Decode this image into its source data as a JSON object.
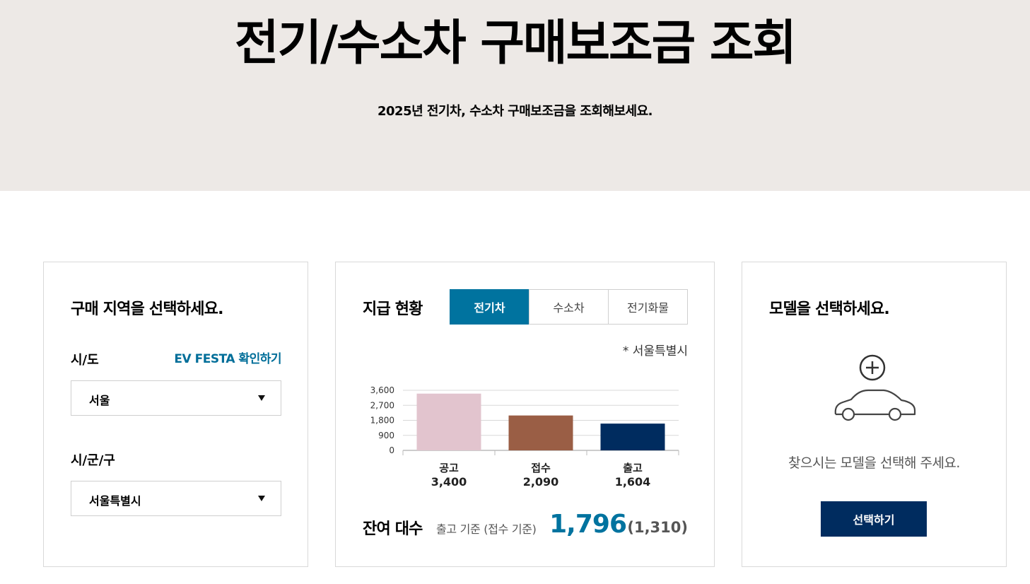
{
  "hero": {
    "title": "전기/수소차 구매보조금 조회",
    "subtitle": "2025년 전기차, 수소차 구매보조금을 조회해보세요."
  },
  "region": {
    "title": "구매 지역을 선택하세요.",
    "sido_label": "시/도",
    "festa_link": "EV FESTA 확인하기",
    "sido_value": "서울",
    "sigungu_label": "시/군/구",
    "sigungu_value": "서울특별시"
  },
  "status": {
    "title": "지급 현황",
    "tabs": [
      {
        "label": "전기차",
        "active": true
      },
      {
        "label": "수소차",
        "active": false
      },
      {
        "label": "전기화물",
        "active": false
      }
    ],
    "region_note": "* 서울특별시",
    "remain_label": "잔여 대수",
    "remain_basis": "출고 기준 (접수 기준)",
    "remain_value": "1,796",
    "remain_sub": "(1,310)"
  },
  "chart_data": {
    "type": "bar",
    "categories": [
      "공고",
      "접수",
      "출고"
    ],
    "values": [
      3400,
      2090,
      1604
    ],
    "value_labels": [
      "3,400",
      "2,090",
      "1,604"
    ],
    "bar_colors": [
      "#e2c4ce",
      "#9a5e45",
      "#002c5f"
    ],
    "y_ticks": [
      0,
      900,
      1800,
      2700,
      3600
    ],
    "y_tick_labels": [
      "0",
      "900",
      "1,800",
      "2,700",
      "3,600"
    ],
    "ylim": [
      0,
      3600
    ],
    "grid": true
  },
  "model": {
    "title": "모델을 선택하세요.",
    "prompt": "찾으시는 모델을 선택해 주세요.",
    "button_label": "선택하기"
  },
  "icons": {
    "add": "plus-circle-icon",
    "car": "car-icon",
    "dropdown": "triangle-down-icon"
  },
  "colors": {
    "accent": "#00739f",
    "navy": "#002c5f",
    "hero_bg": "#ede9e6"
  }
}
